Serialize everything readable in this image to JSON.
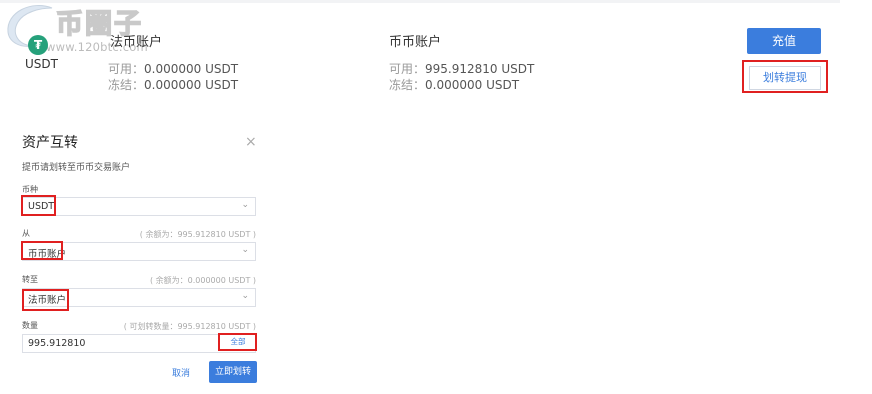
{
  "watermark": {
    "brand": "币圈子",
    "url": "www.120btc.com"
  },
  "coin": {
    "symbol": "USDT",
    "icon": "tether-icon",
    "icon_glyph": "₮",
    "icon_color": "#26a17b"
  },
  "fiat_account": {
    "title": "法币账户",
    "available_label": "可用：",
    "available_value": "0.000000 USDT",
    "frozen_label": "冻结：",
    "frozen_value": "0.000000 USDT"
  },
  "coin_account": {
    "title": "币币账户",
    "available_label": "可用：",
    "available_value": "995.912810 USDT",
    "frozen_label": "冻结：",
    "frozen_value": "0.000000 USDT"
  },
  "actions": {
    "recharge": "充值",
    "transfer": "划转提现"
  },
  "dialog": {
    "title": "资产互转",
    "close_glyph": "×",
    "description": "提币请划转至币币交易账户",
    "currency": {
      "label": "币种",
      "value": "USDT"
    },
    "from": {
      "label": "从",
      "hint": "( 余额为：995.912810 USDT )",
      "value": "币币账户"
    },
    "to": {
      "label": "转至",
      "hint": "( 余额为：0.000000 USDT )",
      "value": "法币账户"
    },
    "amount": {
      "label": "数量",
      "hint": "( 可划转数量：995.912810 USDT )",
      "value": "995.912810",
      "all_label": "全部"
    },
    "cancel": "取消",
    "confirm": "立即划转"
  },
  "colors": {
    "accent": "#3b7ddd",
    "highlight": "#e02020"
  }
}
